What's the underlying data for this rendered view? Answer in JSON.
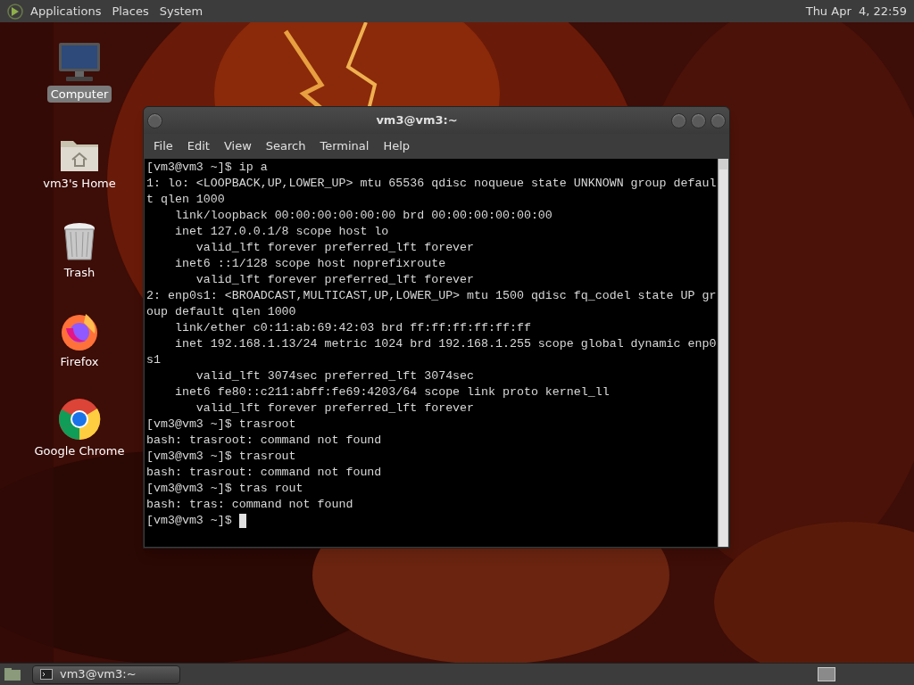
{
  "top_panel": {
    "menus": [
      "Applications",
      "Places",
      "System"
    ],
    "clock": "Thu Apr  4, 22:59"
  },
  "desktop_icons": [
    {
      "kind": "computer",
      "label": "Computer",
      "selected": true
    },
    {
      "kind": "home",
      "label": "vm3's Home",
      "selected": false
    },
    {
      "kind": "trash",
      "label": "Trash",
      "selected": false
    },
    {
      "kind": "firefox",
      "label": "Firefox",
      "selected": false
    },
    {
      "kind": "chrome",
      "label": "Google Chrome",
      "selected": false
    }
  ],
  "terminal": {
    "title": "vm3@vm3:~",
    "menu": [
      "File",
      "Edit",
      "View",
      "Search",
      "Terminal",
      "Help"
    ],
    "lines": [
      "[vm3@vm3 ~]$ ip a",
      "1: lo: <LOOPBACK,UP,LOWER_UP> mtu 65536 qdisc noqueue state UNKNOWN group defaul",
      "t qlen 1000",
      "    link/loopback 00:00:00:00:00:00 brd 00:00:00:00:00:00",
      "    inet 127.0.0.1/8 scope host lo",
      "       valid_lft forever preferred_lft forever",
      "    inet6 ::1/128 scope host noprefixroute",
      "       valid_lft forever preferred_lft forever",
      "2: enp0s1: <BROADCAST,MULTICAST,UP,LOWER_UP> mtu 1500 qdisc fq_codel state UP gr",
      "oup default qlen 1000",
      "    link/ether c0:11:ab:69:42:03 brd ff:ff:ff:ff:ff:ff",
      "    inet 192.168.1.13/24 metric 1024 brd 192.168.1.255 scope global dynamic enp0",
      "s1",
      "       valid_lft 3074sec preferred_lft 3074sec",
      "    inet6 fe80::c211:abff:fe69:4203/64 scope link proto kernel_ll",
      "       valid_lft forever preferred_lft forever",
      "[vm3@vm3 ~]$ trasroot",
      "bash: trasroot: command not found",
      "[vm3@vm3 ~]$ trasrout",
      "bash: trasrout: command not found",
      "[vm3@vm3 ~]$ tras rout",
      "bash: tras: command not found",
      "[vm3@vm3 ~]$ "
    ],
    "cursor": true
  },
  "taskbar": {
    "tasks": [
      {
        "label": "vm3@vm3:~",
        "selected": false
      }
    ]
  }
}
